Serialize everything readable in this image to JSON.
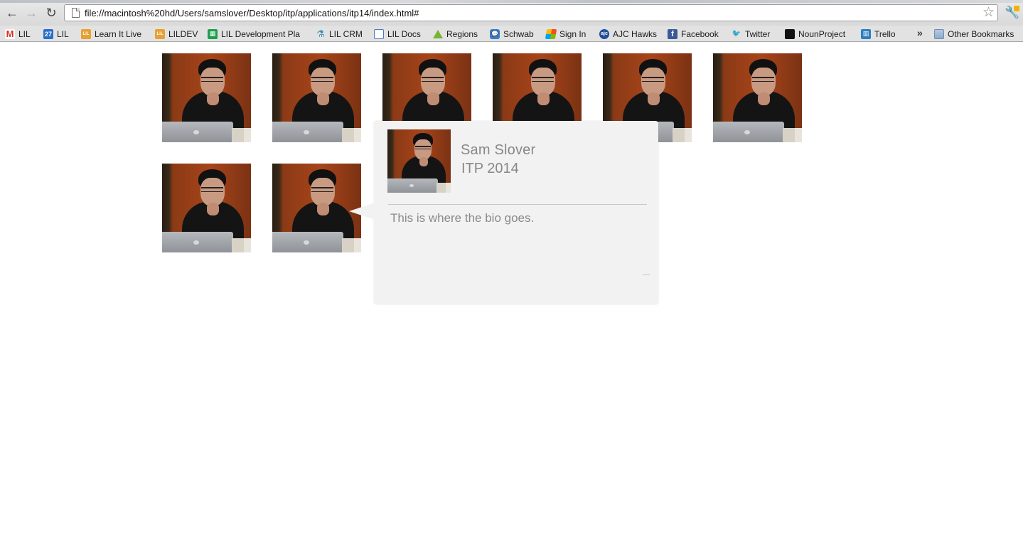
{
  "browser": {
    "url": "file://macintosh%20hd/Users/samslover/Desktop/itp/applications/itp14/index.html#",
    "bookmarks": [
      {
        "label": "LIL",
        "icon": "gmail-icon",
        "glyph": "M"
      },
      {
        "label": "LIL",
        "icon": "calendar-icon",
        "glyph": "27"
      },
      {
        "label": "Learn It Live",
        "icon": "lil-icon",
        "glyph": "LiL"
      },
      {
        "label": "LILDEV",
        "icon": "lil-icon",
        "glyph": "LiL"
      },
      {
        "label": "LIL Development Pla",
        "icon": "spreadsheet-icon",
        "glyph": "▦"
      },
      {
        "label": "LIL CRM",
        "icon": "crm-icon",
        "glyph": "⚗"
      },
      {
        "label": "LIL Docs",
        "icon": "docs-icon",
        "glyph": ""
      },
      {
        "label": "Regions",
        "icon": "regions-icon",
        "glyph": ""
      },
      {
        "label": "Schwab",
        "icon": "schwab-icon",
        "glyph": "💬"
      },
      {
        "label": "Sign In",
        "icon": "windows-icon",
        "glyph": ""
      },
      {
        "label": "AJC Hawks",
        "icon": "ajc-icon",
        "glyph": "ajc"
      },
      {
        "label": "Facebook",
        "icon": "facebook-icon",
        "glyph": "f"
      },
      {
        "label": "Twitter",
        "icon": "twitter-icon",
        "glyph": "🐦"
      },
      {
        "label": "NounProject",
        "icon": "nounproject-icon",
        "glyph": ""
      },
      {
        "label": "Trello",
        "icon": "trello-icon",
        "glyph": "▥"
      }
    ],
    "overflow_label": "»",
    "other_bookmarks_label": "Other Bookmarks"
  },
  "grid": {
    "thumbnail_count": 8,
    "thumbnails": [
      "profile-1",
      "profile-2",
      "profile-3",
      "profile-4",
      "profile-5",
      "profile-6",
      "profile-7",
      "profile-8"
    ]
  },
  "popover": {
    "name": "Sam Slover",
    "program": "ITP 2014",
    "bio": "This is where the bio goes."
  },
  "colors": {
    "popover_bg": "#f2f2f2",
    "popover_text": "#888888",
    "photo_backdrop": "#a8441a"
  }
}
